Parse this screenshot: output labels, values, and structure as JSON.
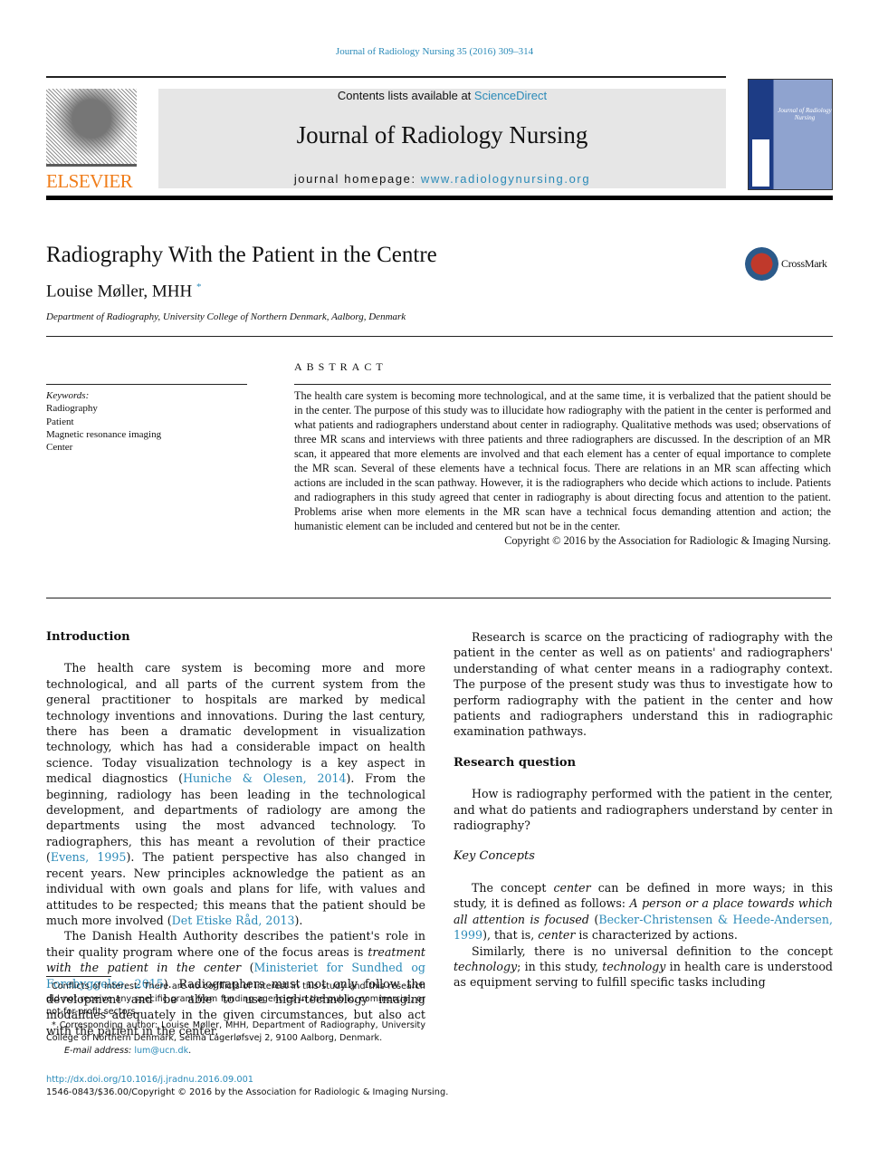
{
  "header": {
    "citation": "Journal of Radiology Nursing 35 (2016) 309–314",
    "contents_prefix": "Contents lists available at ",
    "contents_link": "ScienceDirect",
    "journal_title": "Journal of Radiology Nursing",
    "homepage_prefix": "journal homepage: ",
    "homepage_link": "www.radiologynursing.org",
    "publisher_logo": "ELSEVIER",
    "cover_title": "Journal of Radiology Nursing",
    "crossmark": "CrossMark"
  },
  "article": {
    "title": "Radiography With the Patient in the Centre",
    "author": "Louise Møller, MHH",
    "author_mark": "*",
    "affiliation": "Department of Radiography, University College of Northern Denmark, Aalborg, Denmark"
  },
  "abstract": {
    "heading": "ABSTRACT",
    "text": "The health care system is becoming more technological, and at the same time, it is verbalized that the patient should be in the center. The purpose of this study was to illucidate how radiography with the patient in the center is performed and what patients and radiographers understand about center in radiography. Qualitative methods was used; observations of three MR scans and interviews with three patients and three radiographers are discussed. In the description of an MR scan, it appeared that more elements are involved and that each element has a center of equal importance to complete the MR scan. Several of these elements have a technical focus. There are relations in an MR scan affecting which actions are included in the scan pathway. However, it is the radiographers who decide which actions to include. Patients and radiographers in this study agreed that center in radiography is about directing focus and attention to the patient. Problems arise when more elements in the MR scan have a technical focus demanding attention and action; the humanistic element can be included and centered but not be in the center.",
    "copyright": "Copyright © 2016 by the Association for Radiologic & Imaging Nursing."
  },
  "keywords": {
    "label": "Keywords:",
    "items": [
      "Radiography",
      "Patient",
      "Magnetic resonance imaging",
      "Center"
    ]
  },
  "body": {
    "intro_heading": "Introduction",
    "p1": [
      "The health care system is becoming more and more technological, and all parts of the current system from the general practitioner to hospitals are marked by medical technology inventions and innovations. During the last century, there has been a dramatic development in visualization technology, which has had a considerable impact on health science. Today visualization technology is a key aspect in medical diagnostics (",
      "Huniche & Olesen, 2014",
      "). From the beginning, radiology has been leading in the technological development, and departments of radiology are among the departments using the most advanced technology. To radiographers, this has meant a revolution of their practice (",
      "Evens, 1995",
      "). The patient perspective has also changed in recent years. New principles acknowledge the patient as an individual with own goals and plans for life, with values and attitudes to be respected; this means that the patient should be much more involved (",
      "Det Etiske Råd, 2013",
      "). "
    ],
    "p2": [
      "The Danish Health Authority describes the patient's role in their quality program where one of the focus areas is ",
      "treatment with the patient in the center",
      " (",
      "Ministeriet for Sundhed og Forebyggelse, 2015",
      "). Radiographers must not only follow the development and be able to use high-technology imaging modalities adequately in the given circumstances, but also act with the patient in the center."
    ],
    "p3": "Research is scarce on the practicing of radiography with the patient in the center as well as on patients' and radiographers' understanding of what center means in a radiography context. The purpose of the present study was thus to investigate how to perform radiography with the patient in the center and how patients and radiographers understand this in radiographic examination pathways.",
    "rq_heading": "Research question",
    "rq": "How is radiography performed with the patient in the center, and what do patients and radiographers understand by center in radiography?",
    "kc_heading": "Key Concepts",
    "p4": [
      "The concept ",
      "center",
      " can be defined in more ways; in this study, it is defined as follows: ",
      "A person or a place towards which all attention is focused",
      " (",
      "Becker-Christensen & Heede-Andersen, 1999",
      "), that is, ",
      "center",
      " is characterized by actions."
    ],
    "p5": [
      "Similarly, there is no universal definition to the concept ",
      "technology",
      "; in this study, ",
      "technology",
      " in health care is understood as equipment serving to fulfill specific tasks including"
    ]
  },
  "footnotes": {
    "conflicts": "Conflicts of interest: There are no conflicts of interest in this study and this research did not receive any specific grant from funding agencies in the public, commercial, or not-for-profit sectors.",
    "corresponding": "* Corresponding author: Louise Møller, MHH, Department of Radiography, University College of Northern Denmark, Selma Lagerløfsvej 2, 9100 Aalborg, Denmark.",
    "email_label": "E-mail address: ",
    "email": "lum@ucn.dk",
    "doi": "http://dx.doi.org/10.1016/j.jradnu.2016.09.001",
    "issn": "1546-0843/$36.00/Copyright © 2016 by the Association for Radiologic & Imaging Nursing."
  },
  "colors": {
    "link": "#2a8ab8",
    "elsevier_orange": "#f07d1a",
    "banner_bg": "#e6e6e6"
  }
}
